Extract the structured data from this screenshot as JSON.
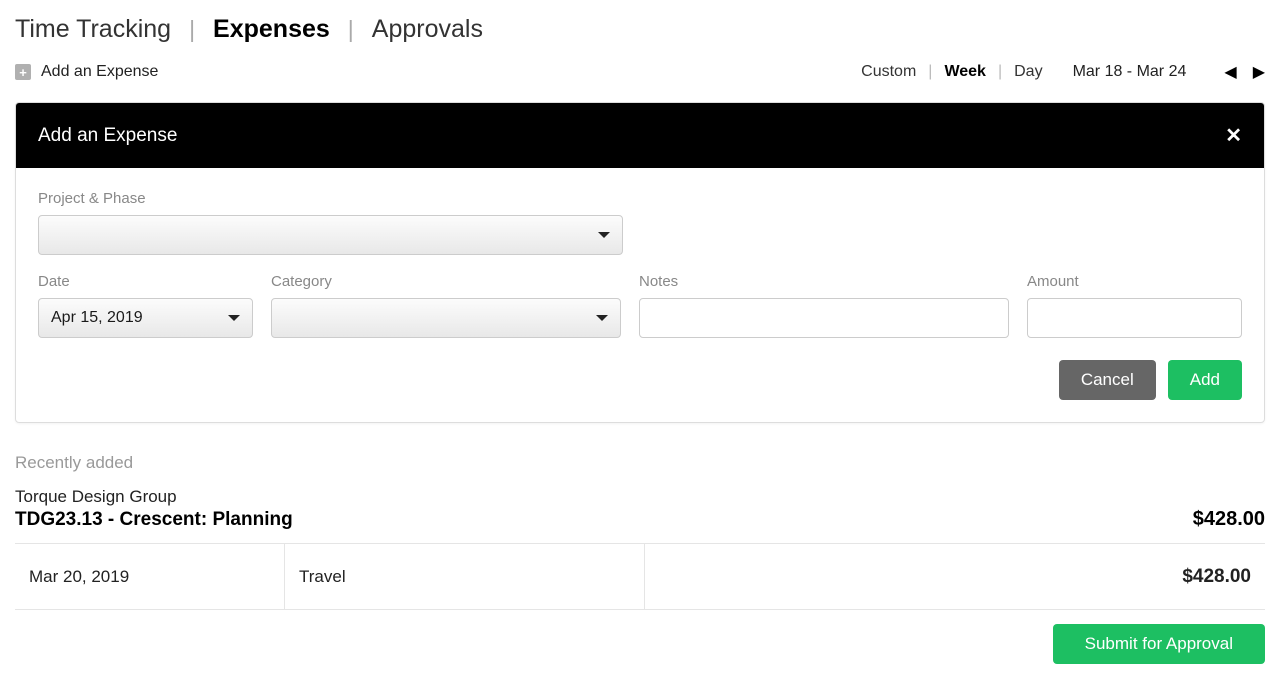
{
  "topnav": {
    "items": [
      "Time Tracking",
      "Expenses",
      "Approvals"
    ],
    "active_index": 1
  },
  "toolbar": {
    "add_expense_label": "Add an Expense",
    "range_options": [
      "Custom",
      "Week",
      "Day"
    ],
    "range_active_index": 1,
    "date_range_label": "Mar 18 - Mar 24"
  },
  "panel": {
    "title": "Add an Expense",
    "labels": {
      "project_phase": "Project & Phase",
      "date": "Date",
      "category": "Category",
      "notes": "Notes",
      "amount": "Amount"
    },
    "values": {
      "project_phase": "",
      "date": "Apr 15, 2019",
      "category": "",
      "notes": "",
      "amount": ""
    },
    "cancel_label": "Cancel",
    "add_label": "Add"
  },
  "recent": {
    "heading": "Recently added",
    "client": "Torque Design Group",
    "project": "TDG23.13 - Crescent: Planning",
    "total": "$428.00",
    "rows": [
      {
        "date": "Mar 20, 2019",
        "category": "Travel",
        "notes": "",
        "amount": "$428.00"
      }
    ]
  },
  "submit_label": "Submit for Approval"
}
